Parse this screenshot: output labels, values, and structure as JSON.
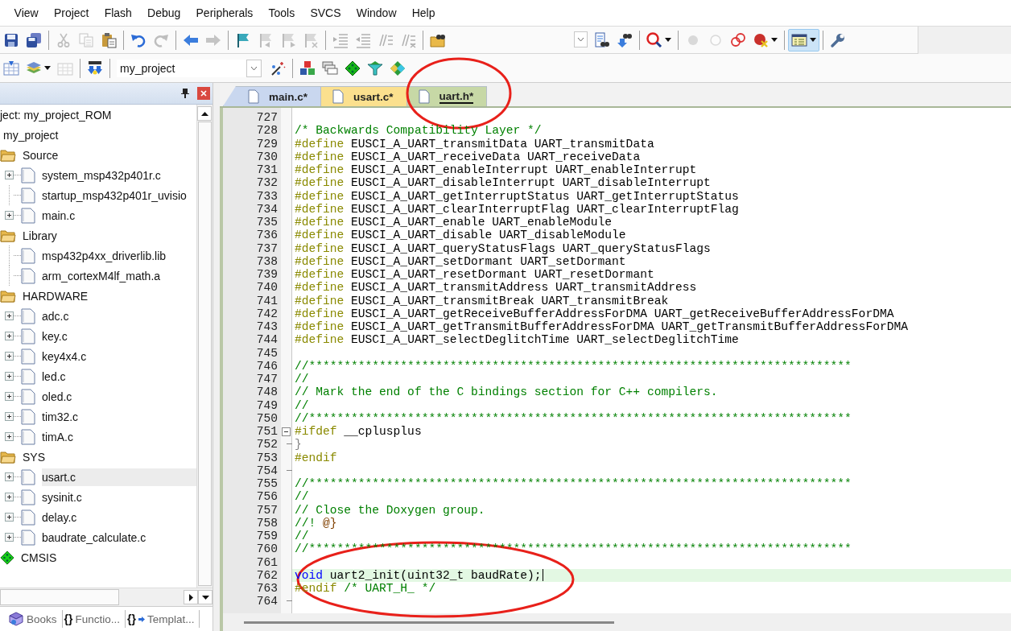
{
  "menu": [
    {
      "label": "View"
    },
    {
      "label": "Project"
    },
    {
      "label": "Flash"
    },
    {
      "label": "Debug"
    },
    {
      "label": "Peripherals"
    },
    {
      "label": "Tools"
    },
    {
      "label": "SVCS"
    },
    {
      "label": "Window"
    },
    {
      "label": "Help"
    }
  ],
  "toolbar_main": [
    {
      "kind": "save",
      "disabled": false,
      "active": false
    },
    {
      "kind": "save-all",
      "disabled": false,
      "active": false
    },
    {
      "kind": "separator"
    },
    {
      "kind": "cut",
      "disabled": true,
      "active": false
    },
    {
      "kind": "copy",
      "disabled": true,
      "active": false
    },
    {
      "kind": "paste",
      "disabled": false,
      "active": false
    },
    {
      "kind": "separator"
    },
    {
      "kind": "undo",
      "disabled": false,
      "active": false
    },
    {
      "kind": "redo",
      "disabled": true,
      "active": false
    },
    {
      "kind": "separator"
    },
    {
      "kind": "back",
      "disabled": false,
      "active": false
    },
    {
      "kind": "forward",
      "disabled": true,
      "active": false
    },
    {
      "kind": "separator"
    },
    {
      "kind": "bookmark",
      "disabled": false,
      "active": false
    },
    {
      "kind": "bookmark-prev",
      "disabled": true,
      "active": false
    },
    {
      "kind": "bookmark-next",
      "disabled": true,
      "active": false
    },
    {
      "kind": "bookmark-clear",
      "disabled": true,
      "active": false
    },
    {
      "kind": "separator"
    },
    {
      "kind": "indent",
      "disabled": true,
      "active": false
    },
    {
      "kind": "unindent",
      "disabled": true,
      "active": false
    },
    {
      "kind": "comment",
      "disabled": true,
      "active": false
    },
    {
      "kind": "uncomment",
      "disabled": true,
      "active": false
    },
    {
      "kind": "separator"
    },
    {
      "kind": "find-in-files",
      "disabled": false,
      "active": false
    },
    {
      "kind": "combo"
    },
    {
      "kind": "find",
      "disabled": false,
      "active": false
    },
    {
      "kind": "find-down",
      "disabled": false,
      "active": false
    },
    {
      "kind": "separator"
    },
    {
      "kind": "debug",
      "disabled": false,
      "active": false,
      "menu": true
    },
    {
      "kind": "separator"
    },
    {
      "kind": "bp-insert",
      "disabled": true,
      "active": false
    },
    {
      "kind": "bp-enable",
      "disabled": true,
      "active": false
    },
    {
      "kind": "bp-disable",
      "disabled": false,
      "active": false
    },
    {
      "kind": "bp-kill",
      "disabled": false,
      "active": false,
      "menu": true
    },
    {
      "kind": "separator"
    },
    {
      "kind": "windows",
      "disabled": false,
      "active": true,
      "menu": true
    },
    {
      "kind": "separator"
    },
    {
      "kind": "wrench",
      "disabled": false,
      "active": false
    }
  ],
  "toolbar_build": [
    {
      "kind": "batch-build",
      "disabled": false
    },
    {
      "kind": "build",
      "disabled": false,
      "menu": true
    },
    {
      "kind": "translate",
      "disabled": true
    },
    {
      "kind": "separator"
    },
    {
      "kind": "load",
      "disabled": false
    },
    {
      "kind": "separator"
    },
    {
      "kind": "target",
      "value": "my_project"
    },
    {
      "kind": "wizard",
      "disabled": false
    },
    {
      "kind": "separator"
    },
    {
      "kind": "components",
      "disabled": false
    },
    {
      "kind": "layers",
      "disabled": false
    },
    {
      "kind": "diamond",
      "disabled": false
    },
    {
      "kind": "funnel",
      "disabled": false
    },
    {
      "kind": "packs",
      "disabled": false
    }
  ],
  "project_panel": {
    "tree": [
      {
        "label": "ject: my_project_ROM",
        "kind": "project",
        "children": [
          {
            "label": "my_project",
            "kind": "target",
            "children": [
              {
                "label": "Source",
                "kind": "folder",
                "children": [
                  {
                    "label": "system_msp432p401r.c",
                    "kind": "file",
                    "expandable": true,
                    "selected": false
                  },
                  {
                    "label": "startup_msp432p401r_uvisio",
                    "kind": "file",
                    "expandable": false,
                    "selected": false
                  },
                  {
                    "label": "main.c",
                    "kind": "file",
                    "expandable": true,
                    "selected": false
                  }
                ]
              },
              {
                "label": "Library",
                "kind": "folder",
                "children": [
                  {
                    "label": "msp432p4xx_driverlib.lib",
                    "kind": "file",
                    "expandable": false,
                    "selected": false
                  },
                  {
                    "label": "arm_cortexM4lf_math.a",
                    "kind": "file",
                    "expandable": false,
                    "selected": false
                  }
                ]
              },
              {
                "label": "HARDWARE",
                "kind": "folder",
                "children": [
                  {
                    "label": "adc.c",
                    "kind": "file",
                    "expandable": true,
                    "selected": false
                  },
                  {
                    "label": "key.c",
                    "kind": "file",
                    "expandable": true,
                    "selected": false
                  },
                  {
                    "label": "key4x4.c",
                    "kind": "file",
                    "expandable": true,
                    "selected": false
                  },
                  {
                    "label": "led.c",
                    "kind": "file",
                    "expandable": true,
                    "selected": false
                  },
                  {
                    "label": "oled.c",
                    "kind": "file",
                    "expandable": true,
                    "selected": false
                  },
                  {
                    "label": "tim32.c",
                    "kind": "file",
                    "expandable": true,
                    "selected": false
                  },
                  {
                    "label": "timA.c",
                    "kind": "file",
                    "expandable": true,
                    "selected": false
                  }
                ]
              },
              {
                "label": "SYS",
                "kind": "folder",
                "children": [
                  {
                    "label": "usart.c",
                    "kind": "file",
                    "expandable": true,
                    "selected": true
                  },
                  {
                    "label": "sysinit.c",
                    "kind": "file",
                    "expandable": true,
                    "selected": false
                  },
                  {
                    "label": "delay.c",
                    "kind": "file",
                    "expandable": true,
                    "selected": false
                  },
                  {
                    "label": "baudrate_calculate.c",
                    "kind": "file",
                    "expandable": true,
                    "selected": false
                  }
                ]
              },
              {
                "label": "CMSIS",
                "kind": "component"
              }
            ]
          }
        ]
      }
    ],
    "tabs": [
      {
        "kind": "books",
        "label": "Books"
      },
      {
        "kind": "functions",
        "glyph": "{}",
        "label": "Functio..."
      },
      {
        "kind": "templates",
        "glyph": "{}",
        "label": "Templat..."
      }
    ]
  },
  "editor": {
    "tabs": [
      {
        "label": "main.c*",
        "color": "#c9d7ef",
        "selected": false
      },
      {
        "label": "usart.c*",
        "color": "#fbe08e",
        "selected": false
      },
      {
        "label": "uart.h*",
        "color": "#c7d8a6",
        "selected": true
      }
    ],
    "lines": [
      {
        "number": "727",
        "kind": "plain",
        "current": false
      },
      {
        "number": "728",
        "kind": "plain",
        "current": false,
        "segments": [
          {
            "kind": "comment",
            "text": "/* Backwards Compatibility Layer */"
          }
        ]
      },
      {
        "number": "729",
        "kind": "plain",
        "current": false,
        "segments": [
          {
            "kind": "directive",
            "text": "#define"
          },
          {
            "kind": "plain",
            "text": " EUSCI_A_UART_transmitData UART_transmitData"
          }
        ]
      },
      {
        "number": "730",
        "kind": "plain",
        "current": false,
        "segments": [
          {
            "kind": "directive",
            "text": "#define"
          },
          {
            "kind": "plain",
            "text": " EUSCI_A_UART_receiveData UART_receiveData"
          }
        ]
      },
      {
        "number": "731",
        "kind": "plain",
        "current": false,
        "segments": [
          {
            "kind": "directive",
            "text": "#define"
          },
          {
            "kind": "plain",
            "text": " EUSCI_A_UART_enableInterrupt UART_enableInterrupt"
          }
        ]
      },
      {
        "number": "732",
        "kind": "plain",
        "current": false,
        "segments": [
          {
            "kind": "directive",
            "text": "#define"
          },
          {
            "kind": "plain",
            "text": " EUSCI_A_UART_disableInterrupt UART_disableInterrupt"
          }
        ]
      },
      {
        "number": "733",
        "kind": "plain",
        "current": false,
        "segments": [
          {
            "kind": "directive",
            "text": "#define"
          },
          {
            "kind": "plain",
            "text": " EUSCI_A_UART_getInterruptStatus UART_getInterruptStatus"
          }
        ]
      },
      {
        "number": "734",
        "kind": "plain",
        "current": false,
        "segments": [
          {
            "kind": "directive",
            "text": "#define"
          },
          {
            "kind": "plain",
            "text": " EUSCI_A_UART_clearInterruptFlag UART_clearInterruptFlag"
          }
        ]
      },
      {
        "number": "735",
        "kind": "plain",
        "current": false,
        "segments": [
          {
            "kind": "directive",
            "text": "#define"
          },
          {
            "kind": "plain",
            "text": " EUSCI_A_UART_enable UART_enableModule"
          }
        ]
      },
      {
        "number": "736",
        "kind": "plain",
        "current": false,
        "segments": [
          {
            "kind": "directive",
            "text": "#define"
          },
          {
            "kind": "plain",
            "text": " EUSCI_A_UART_disable UART_disableModule"
          }
        ]
      },
      {
        "number": "737",
        "kind": "plain",
        "current": false,
        "segments": [
          {
            "kind": "directive",
            "text": "#define"
          },
          {
            "kind": "plain",
            "text": " EUSCI_A_UART_queryStatusFlags UART_queryStatusFlags"
          }
        ]
      },
      {
        "number": "738",
        "kind": "plain",
        "current": false,
        "segments": [
          {
            "kind": "directive",
            "text": "#define"
          },
          {
            "kind": "plain",
            "text": " EUSCI_A_UART_setDormant UART_setDormant"
          }
        ]
      },
      {
        "number": "739",
        "kind": "plain",
        "current": false,
        "segments": [
          {
            "kind": "directive",
            "text": "#define"
          },
          {
            "kind": "plain",
            "text": " EUSCI_A_UART_resetDormant UART_resetDormant"
          }
        ]
      },
      {
        "number": "740",
        "kind": "plain",
        "current": false,
        "segments": [
          {
            "kind": "directive",
            "text": "#define"
          },
          {
            "kind": "plain",
            "text": " EUSCI_A_UART_transmitAddress UART_transmitAddress"
          }
        ]
      },
      {
        "number": "741",
        "kind": "plain",
        "current": false,
        "segments": [
          {
            "kind": "directive",
            "text": "#define"
          },
          {
            "kind": "plain",
            "text": " EUSCI_A_UART_transmitBreak UART_transmitBreak"
          }
        ]
      },
      {
        "number": "742",
        "kind": "plain",
        "current": false,
        "segments": [
          {
            "kind": "directive",
            "text": "#define"
          },
          {
            "kind": "plain",
            "text": " EUSCI_A_UART_getReceiveBufferAddressForDMA UART_getReceiveBufferAddressForDMA"
          }
        ]
      },
      {
        "number": "743",
        "kind": "plain",
        "current": false,
        "segments": [
          {
            "kind": "directive",
            "text": "#define"
          },
          {
            "kind": "plain",
            "text": " EUSCI_A_UART_getTransmitBufferAddressForDMA UART_getTransmitBufferAddressForDMA"
          }
        ]
      },
      {
        "number": "744",
        "kind": "plain",
        "current": false,
        "segments": [
          {
            "kind": "directive",
            "text": "#define"
          },
          {
            "kind": "plain",
            "text": " EUSCI_A_UART_selectDeglitchTime UART_selectDeglitchTime"
          }
        ]
      },
      {
        "number": "745",
        "kind": "plain",
        "current": false
      },
      {
        "number": "746",
        "kind": "plain",
        "current": false,
        "segments": [
          {
            "kind": "comment",
            "text": "//*****************************************************************************"
          }
        ]
      },
      {
        "number": "747",
        "kind": "plain",
        "current": false,
        "segments": [
          {
            "kind": "comment",
            "text": "//"
          }
        ]
      },
      {
        "number": "748",
        "kind": "plain",
        "current": false,
        "segments": [
          {
            "kind": "comment",
            "text": "// Mark the end of the C bindings section for C++ compilers."
          }
        ]
      },
      {
        "number": "749",
        "kind": "plain",
        "current": false,
        "segments": [
          {
            "kind": "comment",
            "text": "//"
          }
        ]
      },
      {
        "number": "750",
        "kind": "plain",
        "current": false,
        "segments": [
          {
            "kind": "comment",
            "text": "//*****************************************************************************"
          }
        ]
      },
      {
        "number": "751",
        "kind": "fold-start",
        "current": false,
        "segments": [
          {
            "kind": "directive",
            "text": "#ifdef"
          },
          {
            "kind": "plain",
            "text": " __cplusplus"
          }
        ]
      },
      {
        "number": "752",
        "kind": "fold-end",
        "current": false,
        "segments": [
          {
            "kind": "inactive",
            "text": "}"
          }
        ]
      },
      {
        "number": "753",
        "kind": "plain",
        "current": false,
        "segments": [
          {
            "kind": "directive",
            "text": "#endif"
          }
        ]
      },
      {
        "number": "754",
        "kind": "fold-end",
        "current": false
      },
      {
        "number": "755",
        "kind": "plain",
        "current": false,
        "segments": [
          {
            "kind": "comment",
            "text": "//*****************************************************************************"
          }
        ]
      },
      {
        "number": "756",
        "kind": "plain",
        "current": false,
        "segments": [
          {
            "kind": "comment",
            "text": "//"
          }
        ]
      },
      {
        "number": "757",
        "kind": "plain",
        "current": false,
        "segments": [
          {
            "kind": "comment",
            "text": "// Close the Doxygen group."
          }
        ]
      },
      {
        "number": "758",
        "kind": "plain",
        "current": false,
        "segments": [
          {
            "kind": "comment",
            "text": "//! "
          },
          {
            "kind": "doc",
            "text": "@}"
          }
        ]
      },
      {
        "number": "759",
        "kind": "plain",
        "current": false,
        "segments": [
          {
            "kind": "comment",
            "text": "//"
          }
        ]
      },
      {
        "number": "760",
        "kind": "plain",
        "current": false,
        "segments": [
          {
            "kind": "comment",
            "text": "//*****************************************************************************"
          }
        ]
      },
      {
        "number": "761",
        "kind": "plain",
        "current": false
      },
      {
        "number": "762",
        "kind": "plain",
        "current": true,
        "segments": [
          {
            "kind": "keyword",
            "text": "void"
          },
          {
            "kind": "plain",
            "text": " uart2_init(uint32_t baudRate);"
          }
        ]
      },
      {
        "number": "763",
        "kind": "plain",
        "current": false,
        "segments": [
          {
            "kind": "directive",
            "text": "#endif"
          },
          {
            "kind": "comment",
            "text": " /* UART_H_ */"
          }
        ]
      },
      {
        "number": "764",
        "kind": "fold-end",
        "current": false
      }
    ]
  }
}
